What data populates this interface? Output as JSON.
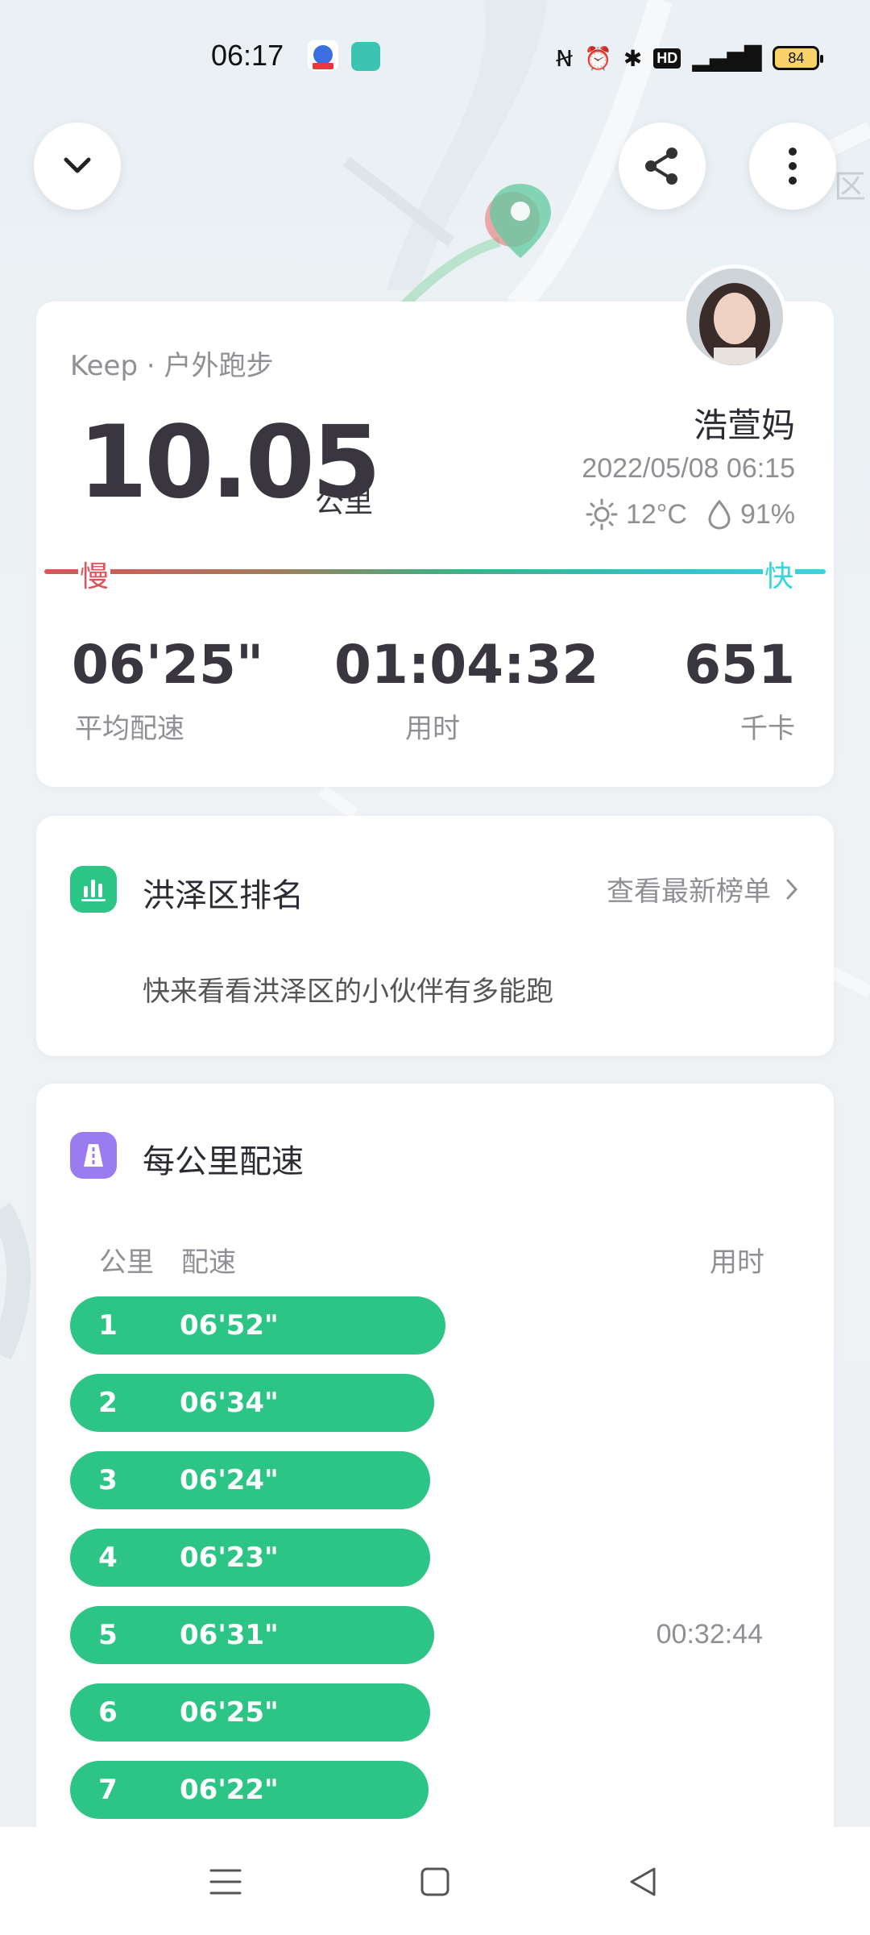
{
  "status_bar": {
    "time": "06:17",
    "battery": "84",
    "icons": [
      "nfc-icon",
      "alarm-icon",
      "bluetooth-icon",
      "hd-icon",
      "5g-signal-icon",
      "battery-icon"
    ],
    "hd": "HD"
  },
  "top_buttons": {
    "collapse": "chevron-down-icon",
    "share": "share-icon",
    "more": "more-vertical-icon"
  },
  "summary": {
    "source": "Keep · 户外跑步",
    "distance": "10.05",
    "distance_unit": "公里",
    "username": "浩萱妈",
    "datetime": "2022/05/08 06:15",
    "temperature": "12°C",
    "humidity": "91%",
    "pace_slow_label": "慢",
    "pace_fast_label": "快",
    "stats": [
      {
        "value": "06'25\"",
        "label": "平均配速"
      },
      {
        "value": "01:04:32",
        "label": "用时"
      },
      {
        "value": "651",
        "label": "千卡"
      }
    ]
  },
  "ranking": {
    "title": "洪泽区排名",
    "link": "查看最新榜单",
    "description": "快来看看洪泽区的小伙伴有多能跑"
  },
  "km_pace": {
    "title": "每公里配速",
    "col_km": "公里",
    "col_pace": "配速",
    "col_time": "用时",
    "rows": [
      {
        "km": "1",
        "pace": "06'52\"",
        "fill": 1.0,
        "time": ""
      },
      {
        "km": "2",
        "pace": "06'34\"",
        "fill": 0.97,
        "time": ""
      },
      {
        "km": "3",
        "pace": "06'24\"",
        "fill": 0.96,
        "time": ""
      },
      {
        "km": "4",
        "pace": "06'23\"",
        "fill": 0.96,
        "time": ""
      },
      {
        "km": "5",
        "pace": "06'31\"",
        "fill": 0.97,
        "time": "00:32:44"
      },
      {
        "km": "6",
        "pace": "06'25\"",
        "fill": 0.96,
        "time": ""
      },
      {
        "km": "7",
        "pace": "06'22\"",
        "fill": 0.955,
        "time": ""
      }
    ]
  },
  "colors": {
    "accent_green": "#2cc586",
    "slow_red": "#e0515a",
    "fast_cyan": "#36d6e0"
  }
}
